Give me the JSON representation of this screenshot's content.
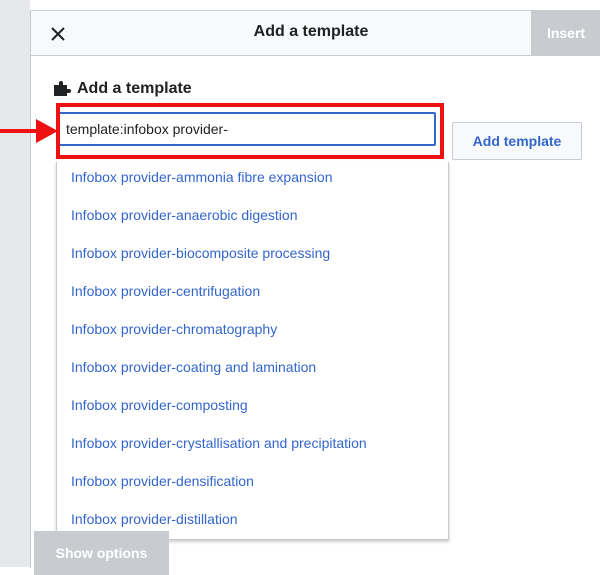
{
  "dialog": {
    "title": "Add a template",
    "close_icon": "close-icon",
    "insert_label": "Insert"
  },
  "section": {
    "heading": "Add a template",
    "heading_icon": "puzzle-piece-icon"
  },
  "search": {
    "value": "template:infobox provider-",
    "placeholder": ""
  },
  "add_button": {
    "label": "Add template"
  },
  "suggestions": [
    "Infobox provider-ammonia fibre expansion",
    "Infobox provider-anaerobic digestion",
    "Infobox provider-biocomposite processing",
    "Infobox provider-centrifugation",
    "Infobox provider-chromatography",
    "Infobox provider-coating and lamination",
    "Infobox provider-composting",
    "Infobox provider-crystallisation and precipitation",
    "Infobox provider-densification",
    "Infobox provider-distillation"
  ],
  "show_options_label": "Show options",
  "colors": {
    "link": "#3366cc",
    "highlight": "#ee1111",
    "disabled_button": "#c8ccd1"
  }
}
